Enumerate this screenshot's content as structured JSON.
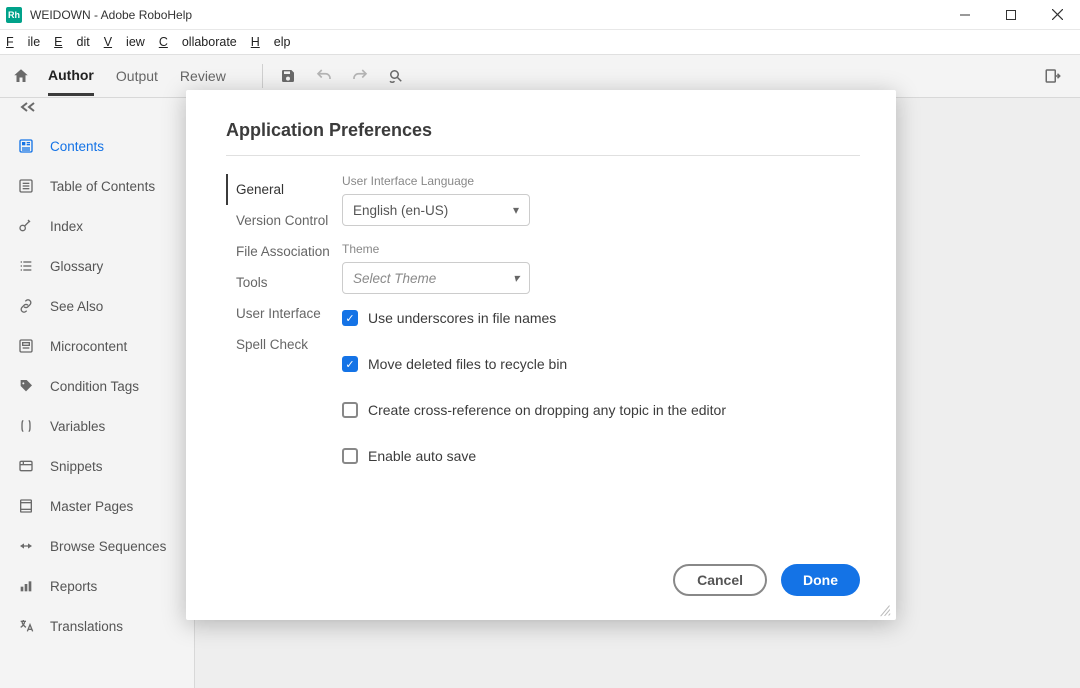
{
  "window": {
    "title": "WEIDOWN - Adobe RoboHelp",
    "app_badge": "Rh"
  },
  "menu": [
    "File",
    "Edit",
    "View",
    "Collaborate",
    "Help"
  ],
  "tabs": {
    "author": "Author",
    "output": "Output",
    "review": "Review"
  },
  "sidebar": [
    {
      "label": "Contents",
      "active": true
    },
    {
      "label": "Table of Contents"
    },
    {
      "label": "Index"
    },
    {
      "label": "Glossary"
    },
    {
      "label": "See Also"
    },
    {
      "label": "Microcontent"
    },
    {
      "label": "Condition Tags"
    },
    {
      "label": "Variables"
    },
    {
      "label": "Snippets"
    },
    {
      "label": "Master Pages"
    },
    {
      "label": "Browse Sequences"
    },
    {
      "label": "Reports"
    },
    {
      "label": "Translations"
    }
  ],
  "modal": {
    "title": "Application Preferences",
    "nav": [
      "General",
      "Version Control",
      "File Association",
      "Tools",
      "User Interface",
      "Spell Check"
    ],
    "language_label": "User Interface Language",
    "language_value": "English (en-US)",
    "theme_label": "Theme",
    "theme_placeholder": "Select Theme",
    "opt_underscores": "Use underscores in file names",
    "opt_recycle": "Move deleted files to recycle bin",
    "opt_crossref": "Create cross-reference on dropping any topic in the editor",
    "opt_autosave": "Enable auto save",
    "cancel": "Cancel",
    "done": "Done"
  }
}
